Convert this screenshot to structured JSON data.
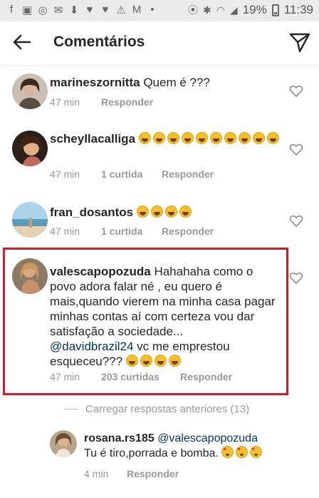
{
  "status": {
    "battery": "19%",
    "time": "11:39"
  },
  "header": {
    "title": "Comentários"
  },
  "actions": {
    "reply": "Responder"
  },
  "comments": [
    {
      "user": "marineszornitta",
      "text": " Quem é ???",
      "emojis": 0,
      "time": "47 min",
      "likes": ""
    },
    {
      "user": "scheyllacalliga",
      "text": "",
      "emojis": 10,
      "time": "47 min",
      "likes": "1 curtida"
    },
    {
      "user": "fran_dosantos",
      "text": "",
      "emojis": 4,
      "time": "47 min",
      "likes": "1 curtida"
    },
    {
      "user": "valescapopozuda",
      "text": " Hahahaha como o povo adora falar né , eu quero é mais,quando vierem na minha casa pagar minhas contas aí com certeza vou dar satisfação a sociedade...",
      "mention": "@davidbrazil24",
      "text2": " vc me emprestou esqueceu???",
      "emojis": 4,
      "time": "47 min",
      "likes": "203 curtidas"
    }
  ],
  "load_more": "Carregar respostas anteriores (13)",
  "reply": {
    "user": "rosana.rs185",
    "mention": "@valescapopozuda",
    "text": "Tu é tiro,porrada e bomba.",
    "emojis": 3,
    "time": "4 min"
  }
}
